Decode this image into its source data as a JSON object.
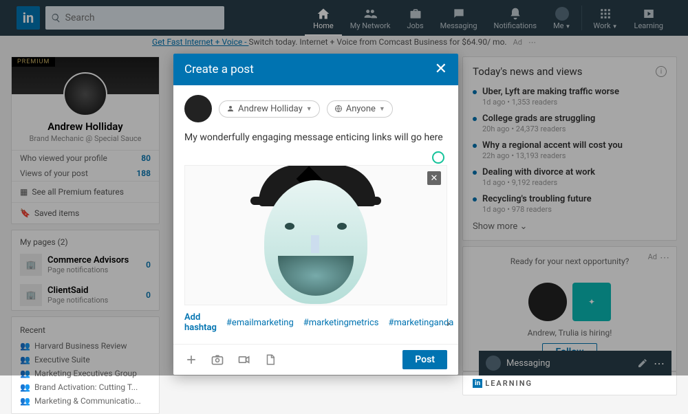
{
  "nav": {
    "search_placeholder": "Search",
    "items": [
      "Home",
      "My Network",
      "Jobs",
      "Messaging",
      "Notifications",
      "Me",
      "Work",
      "Learning"
    ]
  },
  "promo": {
    "link": "Get Fast Internet + Voice - ",
    "text": "Switch today. Internet + Voice from Comcast Business for $64.90/ mo.",
    "ad": "Ad",
    "dots": "⋯"
  },
  "profile": {
    "premium": "PREMIUM",
    "name": "Andrew Holliday",
    "sub": "Brand Mechanic @ Special Sauce",
    "viewed_label": "Who viewed your profile",
    "viewed_count": "80",
    "views_label": "Views of your post",
    "views_count": "188",
    "premium_link": "See all Premium features",
    "saved": "Saved items"
  },
  "mypages": {
    "head": "My pages (2)",
    "items": [
      {
        "name": "Commerce Advisors",
        "sub": "Page notifications",
        "count": "0"
      },
      {
        "name": "ClientSaid",
        "sub": "Page notifications",
        "count": "0"
      }
    ]
  },
  "recent": {
    "head": "Recent",
    "items": [
      "Harvard Business Review",
      "Executive Suite",
      "Marketing Executives Group",
      "Brand Activation: Cutting T...",
      "Marketing & Communicatio..."
    ]
  },
  "news": {
    "head": "Today's news and views",
    "items": [
      {
        "t": "Uber, Lyft are making traffic worse",
        "m": "1d ago • 1,353 readers"
      },
      {
        "t": "College grads are struggling",
        "m": "20h ago • 24,373 readers"
      },
      {
        "t": "Why a regional accent will cost you",
        "m": "22h ago • 13,193 readers"
      },
      {
        "t": "Dealing with divorce at work",
        "m": "1d ago • 9,192 readers"
      },
      {
        "t": "Recycling's troubling future",
        "m": "1d ago • 978 readers"
      }
    ],
    "more": "Show more"
  },
  "ad": {
    "label": "Ad",
    "prompt": "Ready for your next opportunity?",
    "line": "Andrew, Trulia is hiring!",
    "follow": "Follow"
  },
  "learning": {
    "label": "LEARNING"
  },
  "msgdock": {
    "label": "Messaging"
  },
  "modal": {
    "title": "Create a post",
    "author": "Andrew Holliday",
    "visibility": "Anyone",
    "text": "My wonderfully engaging message enticing links will go here",
    "add_hashtag": "Add hashtag",
    "tags": [
      "#emailmarketing",
      "#marketingmetrics",
      "#marketinganda"
    ],
    "post": "Post"
  }
}
